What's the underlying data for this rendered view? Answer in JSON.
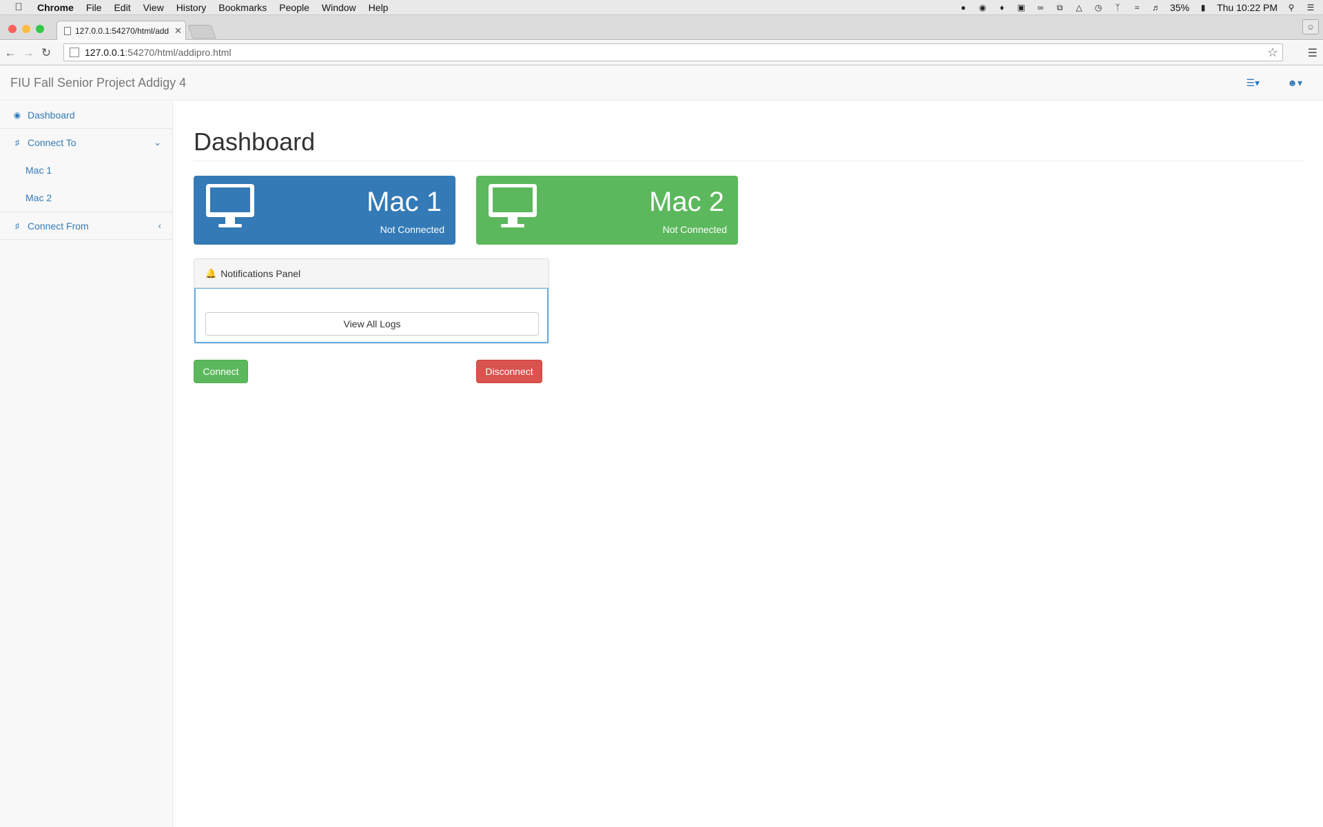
{
  "os_menubar": {
    "app": "Chrome",
    "items": [
      "File",
      "Edit",
      "View",
      "History",
      "Bookmarks",
      "People",
      "Window",
      "Help"
    ],
    "battery": "35%",
    "clock": "Thu 10:22 PM"
  },
  "browser": {
    "tab_title": "127.0.0.1:54270/html/add",
    "url_host": "127.0.0.1",
    "url_path": ":54270/html/addipro.html"
  },
  "navbar": {
    "brand": "FIU Fall Senior Project Addigy 4"
  },
  "sidebar": {
    "dashboard": "Dashboard",
    "connect_to": "Connect To",
    "mac1": "Mac 1",
    "mac2": "Mac 2",
    "connect_from": "Connect From"
  },
  "main": {
    "title": "Dashboard",
    "cards": [
      {
        "name": "Mac 1",
        "status": "Not Connected",
        "color": "#337ab7"
      },
      {
        "name": "Mac 2",
        "status": "Not Connected",
        "color": "#5cb85c"
      }
    ],
    "notifications": {
      "heading": "Notifications Panel",
      "view_all": "View All Logs"
    },
    "connect_label": "Connect",
    "disconnect_label": "Disconnect"
  },
  "colors": {
    "link": "#337ab7",
    "success": "#5cb85c",
    "danger": "#d9534f"
  }
}
